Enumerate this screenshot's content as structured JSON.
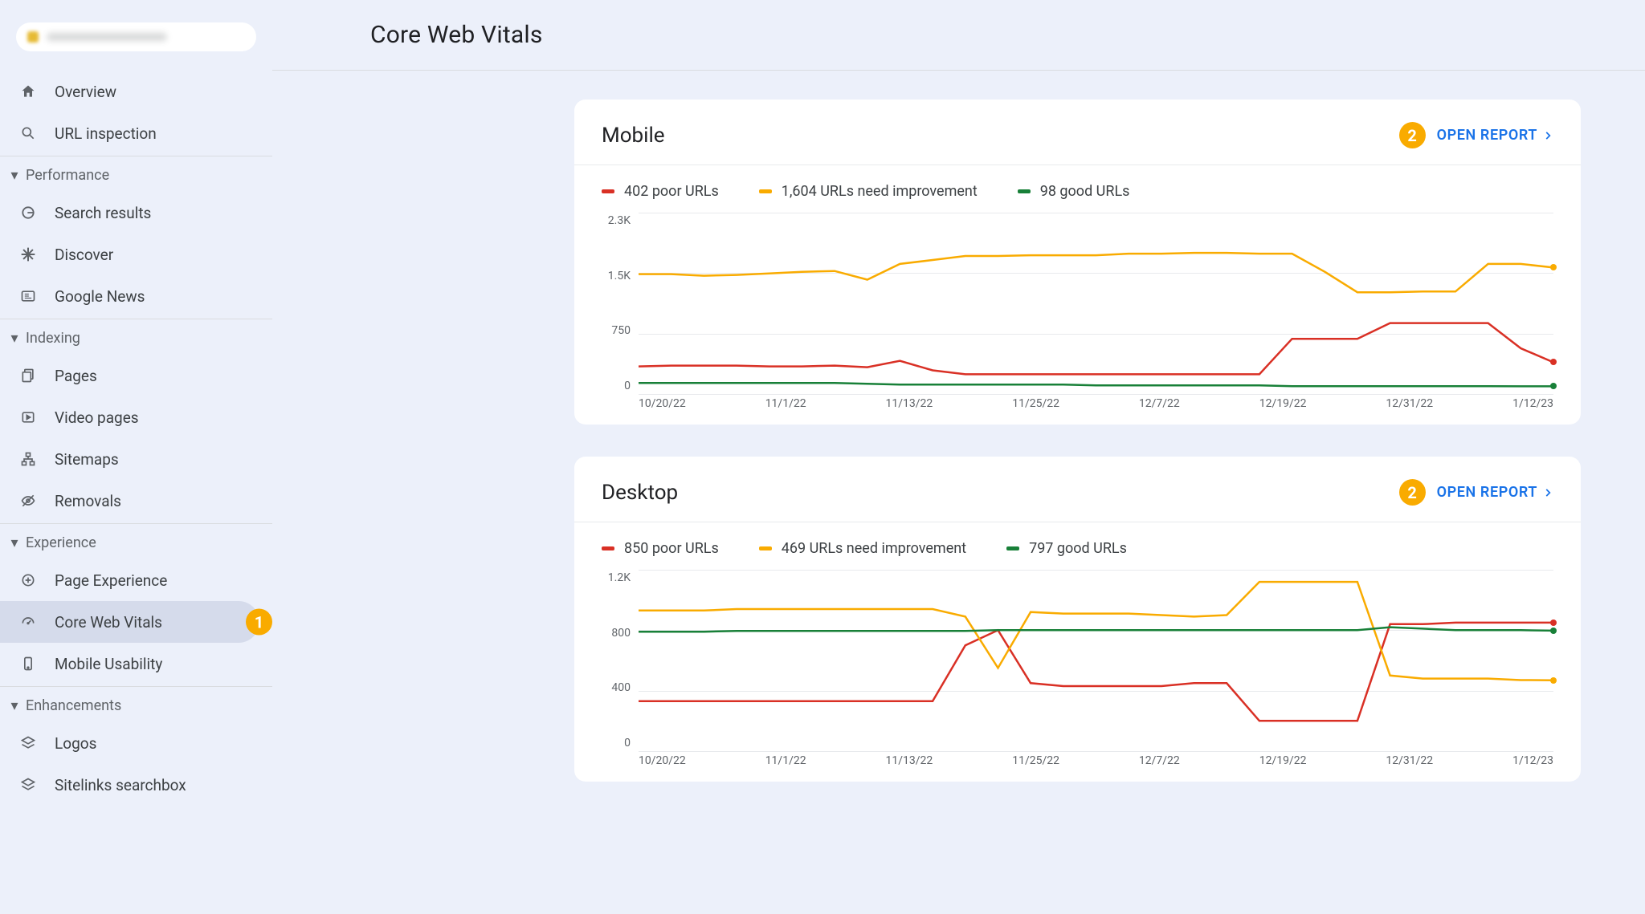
{
  "page": {
    "title": "Core Web Vitals"
  },
  "sidebar": {
    "items": {
      "overview": "Overview",
      "url_inspection": "URL inspection",
      "search_results": "Search results",
      "discover": "Discover",
      "google_news": "Google News",
      "pages": "Pages",
      "video_pages": "Video pages",
      "sitemaps": "Sitemaps",
      "removals": "Removals",
      "page_experience": "Page Experience",
      "core_web_vitals": "Core Web Vitals",
      "mobile_usability": "Mobile Usability",
      "logos": "Logos",
      "sitelinks_searchbox": "Sitelinks searchbox"
    },
    "groups": {
      "performance": "Performance",
      "indexing": "Indexing",
      "experience": "Experience",
      "enhancements": "Enhancements"
    }
  },
  "annotations": {
    "marker_sidebar": "1",
    "marker_card": "2"
  },
  "open_report_label": "OPEN REPORT",
  "cards": {
    "mobile": {
      "title": "Mobile",
      "legend": {
        "poor": "402 poor URLs",
        "improve": "1,604 URLs need improvement",
        "good": "98 good URLs"
      }
    },
    "desktop": {
      "title": "Desktop",
      "legend": {
        "poor": "850 poor URLs",
        "improve": "469 URLs need improvement",
        "good": "797 good URLs"
      }
    }
  },
  "chart_data": [
    {
      "card": "mobile",
      "type": "line",
      "x": [
        "10/20/22",
        "11/1/22",
        "11/13/22",
        "11/25/22",
        "12/7/22",
        "12/19/22",
        "12/31/22",
        "1/12/23"
      ],
      "ylim": [
        0,
        2300
      ],
      "yticks": [
        "2.3K",
        "1.5K",
        "750",
        "0"
      ],
      "series": [
        {
          "name": "poor",
          "color": "#d93025",
          "values": [
            350,
            360,
            360,
            360,
            350,
            350,
            360,
            340,
            420,
            300,
            250,
            250,
            250,
            250,
            250,
            250,
            250,
            250,
            250,
            250,
            700,
            700,
            700,
            900,
            900,
            900,
            900,
            580,
            402
          ]
        },
        {
          "name": "improve",
          "color": "#f9ab00",
          "values": [
            1520,
            1520,
            1500,
            1510,
            1530,
            1550,
            1560,
            1450,
            1650,
            1700,
            1750,
            1750,
            1760,
            1760,
            1760,
            1780,
            1780,
            1790,
            1790,
            1780,
            1780,
            1550,
            1290,
            1290,
            1300,
            1300,
            1650,
            1650,
            1604
          ]
        },
        {
          "name": "good",
          "color": "#188038",
          "values": [
            140,
            140,
            140,
            140,
            140,
            140,
            140,
            130,
            120,
            120,
            120,
            120,
            120,
            120,
            110,
            110,
            110,
            110,
            110,
            110,
            100,
            100,
            100,
            100,
            100,
            100,
            100,
            98,
            98
          ]
        }
      ]
    },
    {
      "card": "desktop",
      "type": "line",
      "x": [
        "10/20/22",
        "11/1/22",
        "11/13/22",
        "11/25/22",
        "12/7/22",
        "12/19/22",
        "12/31/22",
        "1/12/23"
      ],
      "ylim": [
        0,
        1200
      ],
      "yticks": [
        "1.2K",
        "800",
        "400",
        "0"
      ],
      "series": [
        {
          "name": "poor",
          "color": "#d93025",
          "values": [
            330,
            330,
            330,
            330,
            330,
            330,
            330,
            330,
            330,
            330,
            700,
            800,
            450,
            430,
            430,
            430,
            430,
            450,
            450,
            200,
            200,
            200,
            200,
            840,
            840,
            850,
            850,
            850,
            850
          ]
        },
        {
          "name": "improve",
          "color": "#f9ab00",
          "values": [
            930,
            930,
            930,
            940,
            940,
            940,
            940,
            940,
            940,
            940,
            890,
            550,
            920,
            910,
            910,
            910,
            900,
            890,
            900,
            1120,
            1120,
            1120,
            1120,
            500,
            480,
            480,
            480,
            470,
            469
          ]
        },
        {
          "name": "good",
          "color": "#188038",
          "values": [
            790,
            790,
            790,
            795,
            795,
            795,
            795,
            795,
            795,
            795,
            795,
            800,
            800,
            800,
            800,
            800,
            800,
            800,
            800,
            800,
            800,
            800,
            800,
            820,
            810,
            800,
            800,
            800,
            797
          ]
        }
      ]
    }
  ]
}
